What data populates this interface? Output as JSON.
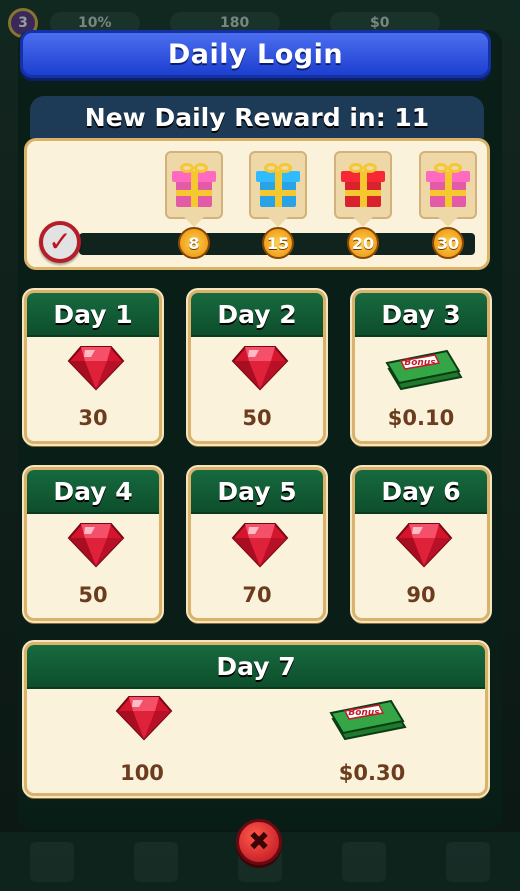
{
  "hud": {
    "level": "3",
    "percent": "10%",
    "gems": "180",
    "cash": "$0"
  },
  "title": "Daily Login",
  "timer_text": "New Daily Reward in: 11",
  "milestones": [
    "8",
    "15",
    "20",
    "30"
  ],
  "gift_colors": [
    "#e35ba7",
    "#2aa3e6",
    "#d8222e",
    "#e35ba7"
  ],
  "days": [
    {
      "label": "Day 1",
      "reward": "ruby",
      "value": "30"
    },
    {
      "label": "Day 2",
      "reward": "ruby",
      "value": "50"
    },
    {
      "label": "Day 3",
      "reward": "cash",
      "value": "$0.10"
    },
    {
      "label": "Day 4",
      "reward": "ruby",
      "value": "50"
    },
    {
      "label": "Day 5",
      "reward": "ruby",
      "value": "70"
    },
    {
      "label": "Day 6",
      "reward": "ruby",
      "value": "90"
    }
  ],
  "day7": {
    "label": "Day 7",
    "ruby_value": "100",
    "cash_value": "$0.30"
  },
  "bonus_label": "Bonus",
  "colors": {
    "title_blue": "#2b4fd8",
    "card_header_green": "#136238",
    "card_bg": "#fbf2dc",
    "value_brown": "#6b3d1e"
  },
  "icons": {
    "close": "close-icon",
    "check": "checkmark-icon",
    "gem": "ruby-icon",
    "cash": "cash-bonus-icon",
    "gift": "gift-box-icon"
  }
}
